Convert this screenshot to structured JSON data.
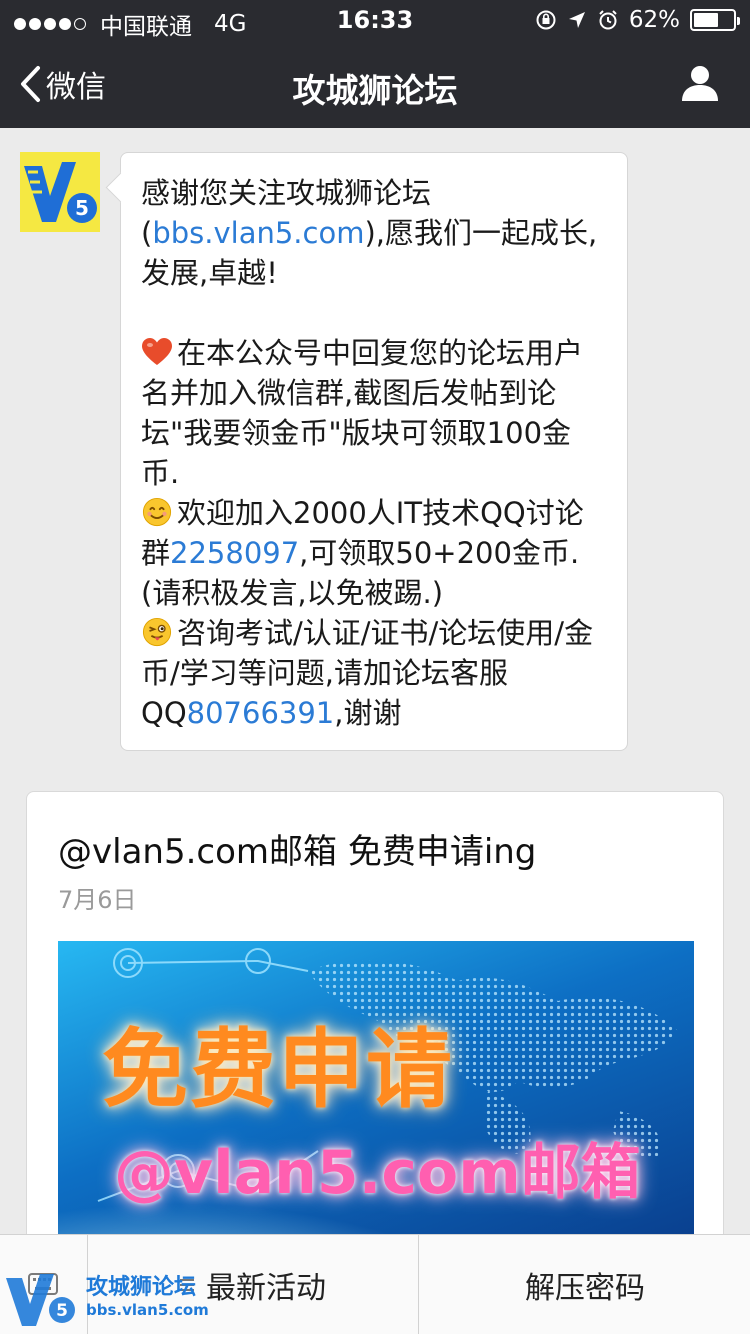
{
  "status_bar": {
    "carrier": "中国联通",
    "network": "4G",
    "time": "16:33",
    "battery": "62%",
    "battery_level": 0.62
  },
  "nav": {
    "back_label": "微信",
    "title": "攻城狮论坛"
  },
  "message": {
    "intro_before": "感谢您关注攻城狮论坛(",
    "intro_link": "bbs.vlan5.com",
    "intro_after": "),愿我们一起成长,发展,卓越!",
    "item1": "在本公众号中回复您的论坛用户名并加入微信群,截图后发帖到论坛\"我要领金币\"版块可领取100金币.",
    "item2_before": "欢迎加入2000人IT技术QQ讨论群",
    "item2_link": "2258097",
    "item2_after": ",可领取50+200金币.(请积极发言,以免被踢.)",
    "item3_before": "咨询考试/认证/证书/论坛使用/金币/学习等问题,请加论坛客服QQ",
    "item3_link": "80766391",
    "item3_after": ",谢谢"
  },
  "article": {
    "title": "@vlan5.com邮箱  免费申请ing",
    "date": "7月6日",
    "cover_line1": "免费申请",
    "cover_line2": "@vlan5.com邮箱"
  },
  "menu": {
    "item1": "最新活动",
    "item2": "解压密码"
  },
  "watermark": {
    "name": "攻城狮论坛",
    "url": "bbs.vlan5.com"
  },
  "colors": {
    "nav_bg": "#2a2b30",
    "link": "#2b7bd5",
    "avatar_bg": "#f5e842",
    "logo_blue": "#1f7ad8"
  }
}
